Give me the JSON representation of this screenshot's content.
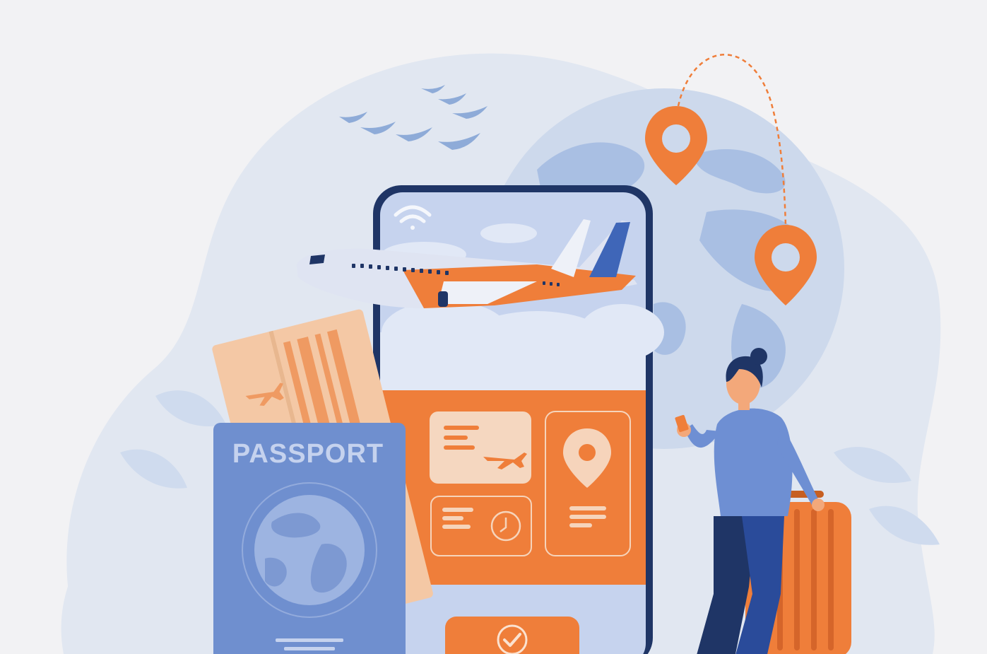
{
  "illustration": {
    "passport_label": "PASSPORT"
  },
  "colors": {
    "background": "#f2f2f4",
    "blob": "#dfe6f1",
    "globe": "#c9d6ea",
    "globe_land": "#a9bfe2",
    "accent_orange": "#ef7e3a",
    "phone_frame": "#1f3566",
    "phone_sky": "#c3d1ee",
    "passport_blue": "#6f8fcf",
    "ticket_peach": "#f4c8a5",
    "person_sweater": "#6e8fd3",
    "person_pants": "#2a4b9a",
    "suitcase": "#ef7e3a"
  },
  "icons": [
    "wifi-icon",
    "airplane-icon",
    "location-pin-icon",
    "clock-icon",
    "checkmark-icon",
    "bird-icon",
    "globe-icon"
  ]
}
